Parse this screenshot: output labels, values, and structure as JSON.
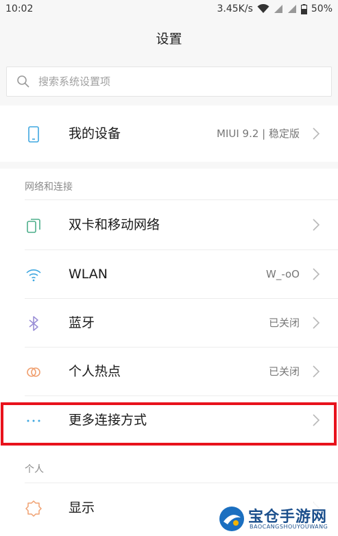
{
  "status_bar": {
    "time": "10:02",
    "speed": "3.45K/s",
    "battery": "50%",
    "icons": [
      "wifi-icon",
      "signal-icon",
      "signal-icon",
      "battery-icon"
    ]
  },
  "title": "设置",
  "search": {
    "placeholder": "搜索系统设置项",
    "value": ""
  },
  "my_device": {
    "label": "我的设备",
    "value": "MIUI 9.2 | 稳定版",
    "icon": "phone-icon"
  },
  "sections": {
    "network": "网络和连接",
    "personal": "个人"
  },
  "network_items": [
    {
      "label": "双卡和移动网络",
      "value": "",
      "icon": "dual-sim-icon"
    },
    {
      "label": "WLAN",
      "value": "W_-oO",
      "icon": "wifi-icon"
    },
    {
      "label": "蓝牙",
      "value": "已关闭",
      "icon": "bluetooth-icon"
    },
    {
      "label": "个人热点",
      "value": "已关闭",
      "icon": "hotspot-icon"
    },
    {
      "label": "更多连接方式",
      "value": "",
      "icon": "more-dots-icon"
    }
  ],
  "personal_items": [
    {
      "label": "显示",
      "value": "",
      "icon": "display-sun-icon"
    }
  ],
  "watermark": {
    "title": "宝仓手游网",
    "subtitle": "BAOCANGSHOUYOUWANG"
  },
  "colors": {
    "background": "#f7f7f7",
    "highlight": "#e8121c",
    "icon_blue": "#3fa7e0",
    "icon_green": "#4cae8a",
    "icon_purple": "#9b8fd6",
    "icon_orange": "#f0a070"
  }
}
